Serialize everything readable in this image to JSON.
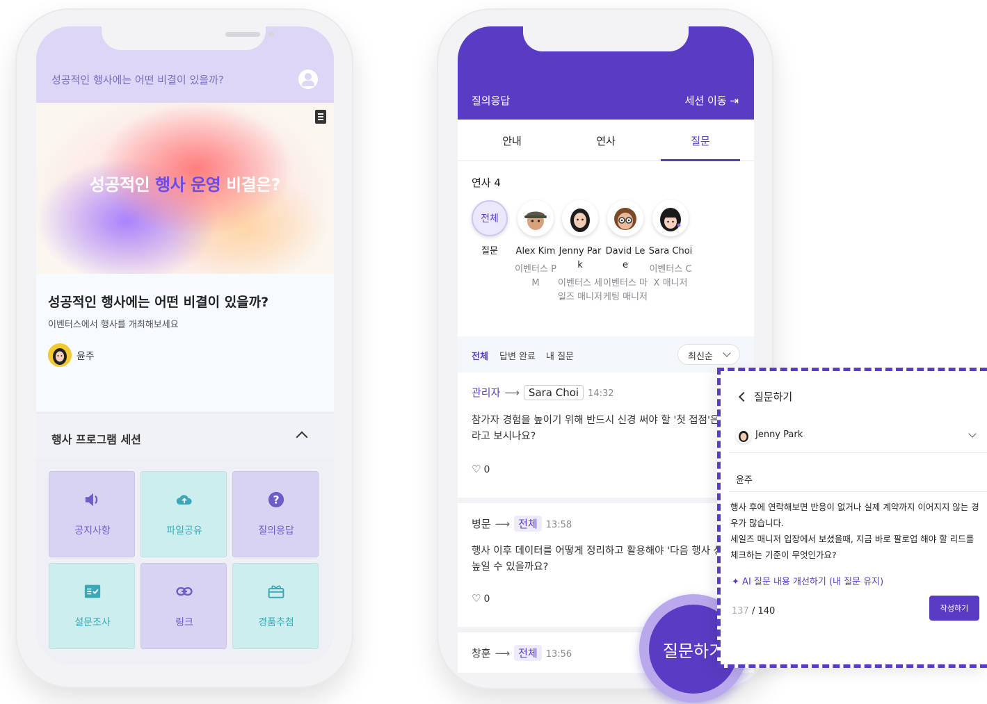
{
  "left_phone": {
    "header_title": "성공적인 행사에는 어떤 비결이 있을까?",
    "banner": {
      "title_part1": "성공적인 ",
      "title_highlight": "행사 운영",
      "title_part2": " 비결은?"
    },
    "event": {
      "title": "성공적인 행사에는 어떤 비결이 있을까?",
      "subtitle": "이벤터스에서 행사를 개최해보세요",
      "host_name": "윤주"
    },
    "section": {
      "title": "행사 프로그램 세션"
    },
    "tiles": [
      {
        "label": "공지사항",
        "icon": "speaker-icon",
        "color": "purple"
      },
      {
        "label": "파일공유",
        "icon": "cloud-upload-icon",
        "color": "teal"
      },
      {
        "label": "질의응답",
        "icon": "question-icon",
        "color": "purple"
      },
      {
        "label": "설문조사",
        "icon": "survey-icon",
        "color": "teal"
      },
      {
        "label": "링크",
        "icon": "link-icon",
        "color": "purple"
      },
      {
        "label": "경품추첨",
        "icon": "gift-icon",
        "color": "teal"
      }
    ]
  },
  "right_phone": {
    "header_title": "질의응답",
    "move_session": "세션 이동",
    "tabs": [
      {
        "label": "안내",
        "active": false
      },
      {
        "label": "연사",
        "active": false
      },
      {
        "label": "질문",
        "active": true
      }
    ],
    "speakers_count": "연사 4",
    "speakers": [
      {
        "avatar_text": "전체",
        "name": "질문",
        "role": ""
      },
      {
        "name": "Alex Kim",
        "role": "이벤터스 PM"
      },
      {
        "name": "Jenny Park",
        "role": "이벤터스 세일즈 매니저"
      },
      {
        "name": "David Lee",
        "role": "이벤터스 마케팅 매니저"
      },
      {
        "name": "Sara Choi",
        "role": "이벤터스 CX 매니저"
      }
    ],
    "filters": [
      "전체",
      "답변 완료",
      "내 질문"
    ],
    "sort": "최신순",
    "questions": [
      {
        "from": "관리자",
        "to": "Sara Choi",
        "time": "14:32",
        "text_line1": "참가자 경험을 높이기 위해 반드시 신경 써야 할 '첫 접점'은 어",
        "text_line2": "라고 보시나요?",
        "likes": "0"
      },
      {
        "from": "병문",
        "to": "전체",
        "time": "13:58",
        "text_line1": "행사 이후 데이터를 어떻게 정리하고 활용해야 '다음 행사 성과'를",
        "text_line2": "높일 수 있을까요?",
        "likes": "0"
      },
      {
        "from": "창훈",
        "to": "전체",
        "time": "13:56"
      }
    ],
    "ask_button": "질문하기"
  },
  "popup": {
    "title": "질문하기",
    "speaker": "Jenny Park",
    "name": "윤주",
    "text_line1": "행사 후에 연락해보면 반응이 없거나 실제 계약까지 이어지지 않는 경",
    "text_line2": "우가 많습니다.",
    "text_line3": "세일즈 매니저 입장에서 보셨을때, 지금 바로 팔로업 해야 할 리드를",
    "text_line4": "체크하는 기준이 무엇인가요?",
    "ai_improve": "AI 질문 내용 개선하기 (내 질문 유지)",
    "char_count": "137",
    "char_max": " / 140",
    "submit": "작성하기"
  },
  "colors": {
    "brand": "#5a3cc4",
    "brand_light": "#ddd6f6",
    "tile_purple": "#d8d2f3",
    "tile_teal": "#cdeeee"
  }
}
